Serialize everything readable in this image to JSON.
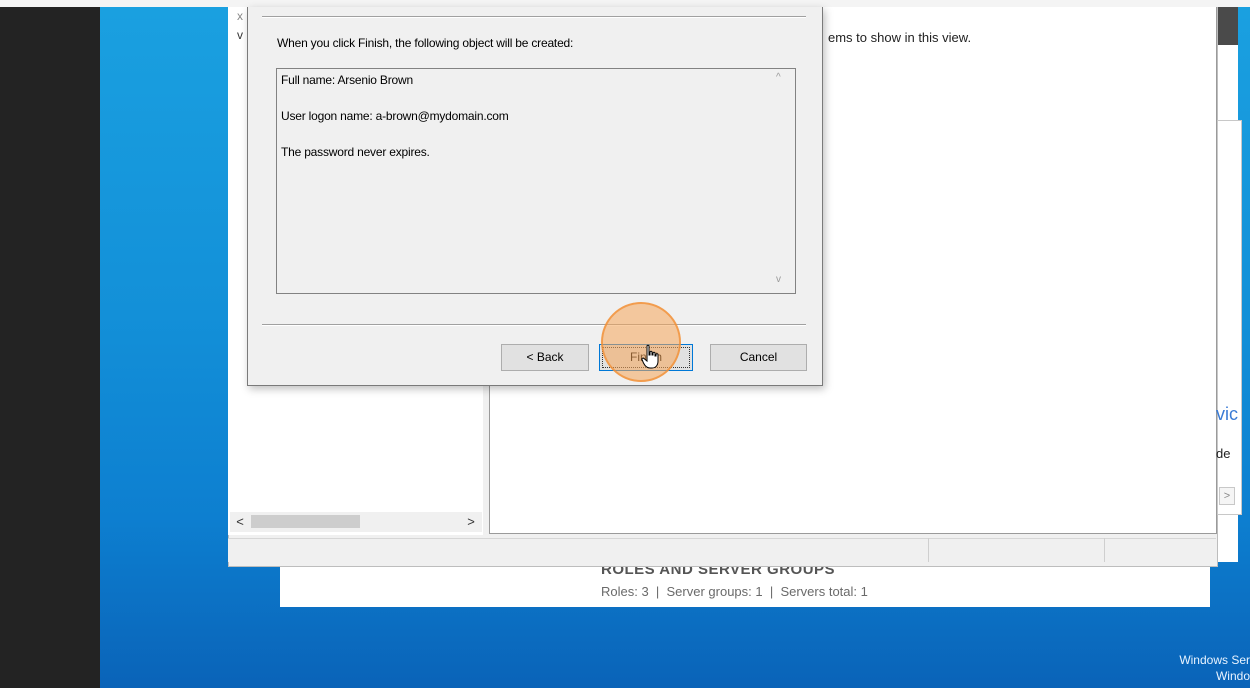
{
  "dialog": {
    "intro": "When you click Finish, the following object will be created:",
    "summary": [
      "Full name: Arsenio Brown",
      "User logon name: a-brown@mydomain.com",
      "The password never expires."
    ],
    "buttons": {
      "back": "< Back",
      "finish": "Finish",
      "cancel": "Cancel"
    }
  },
  "aduc": {
    "empty_message": "ems to show in this view."
  },
  "server_manager": {
    "roles_title": "ROLES AND SERVER GROUPS",
    "roles_stats": "Roles: 3  |  Server groups: 1  |  Servers total: 1"
  },
  "right_edge": {
    "text1": "vic",
    "text2": "de"
  },
  "watermark": {
    "line1": "Windows Ser",
    "line2": "Windo"
  },
  "icons": {
    "scroll_left": "<",
    "scroll_right": ">",
    "scroll_up": "^",
    "scroll_down": "v",
    "close": "x",
    "chevron": "v"
  },
  "colors": {
    "desktop": "#1390d8",
    "click_highlight": "#f5a55a",
    "focus_border": "#0078d7"
  }
}
